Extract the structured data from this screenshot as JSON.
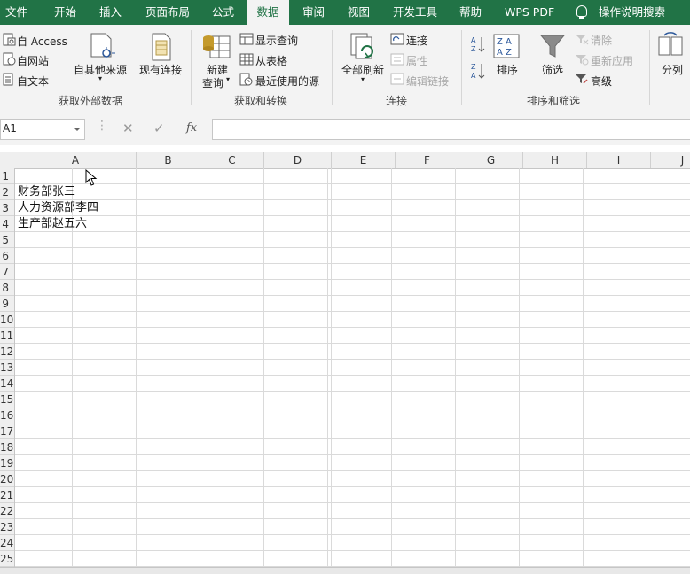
{
  "menu": {
    "tabs": [
      "文件",
      "开始",
      "插入",
      "页面布局",
      "公式",
      "数据",
      "审阅",
      "视图",
      "开发工具",
      "帮助",
      "WPS PDF"
    ],
    "active": "数据",
    "tell_me": "操作说明搜索"
  },
  "ribbon": {
    "external": {
      "from_access": "自 Access",
      "from_web": "自网站",
      "from_text": "自文本",
      "from_other": "自其他来源",
      "existing": "现有连接",
      "group": "获取外部数据"
    },
    "transform": {
      "new_query_1": "新建",
      "new_query_2": "查询",
      "show_queries": "显示查询",
      "from_table": "从表格",
      "recent_sources": "最近使用的源",
      "group": "获取和转换"
    },
    "connections": {
      "refresh_all": "全部刷新",
      "connections": "连接",
      "properties": "属性",
      "edit_links": "编辑链接",
      "group": "连接"
    },
    "sort_filter": {
      "sort": "排序",
      "filter": "筛选",
      "clear": "清除",
      "reapply": "重新应用",
      "advanced": "高级",
      "group": "排序和筛选"
    },
    "data_tools": {
      "text_to_columns": "分列"
    }
  },
  "formula_bar": {
    "name_box": "A1",
    "cancel": "✕",
    "confirm": "✓",
    "fx": "fx",
    "value": ""
  },
  "sheet": {
    "columns": [
      "A",
      "B",
      "C",
      "D",
      "E",
      "F",
      "G",
      "H",
      "I",
      "J"
    ],
    "rows": [
      "1",
      "2",
      "3",
      "4",
      "5",
      "6",
      "7",
      "8",
      "9",
      "10",
      "11",
      "12",
      "13",
      "14",
      "15",
      "16",
      "17",
      "18",
      "19",
      "20",
      "21",
      "22",
      "23",
      "24",
      "25"
    ],
    "cells": {
      "A2": "财务部张三",
      "A3": "人力资源部李四",
      "A4": "生产部赵五六"
    }
  },
  "colors": {
    "brand_green": "#217346",
    "ribbon_bg": "#f3f3f3"
  }
}
